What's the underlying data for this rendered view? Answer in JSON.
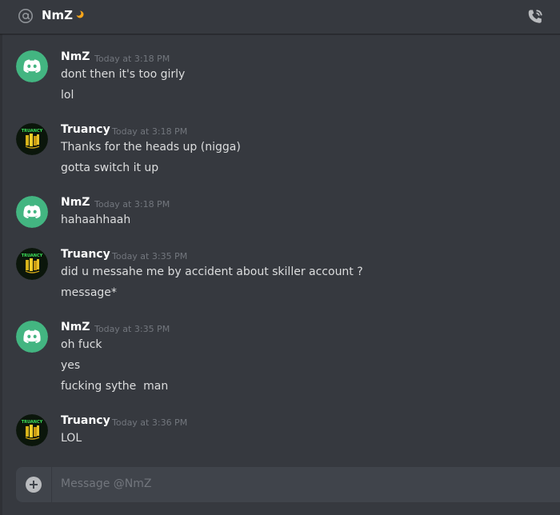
{
  "header": {
    "title": "NmZ",
    "icon": "at-icon",
    "status_icon": "moon-icon",
    "call_icon": "phone-call-icon"
  },
  "colors": {
    "background": "#36393f",
    "discord_green": "#43b581",
    "username": "#ffffff",
    "timestamp": "#72767d",
    "text": "#dcddde",
    "composer": "#40444b"
  },
  "messages": [
    {
      "author": "NmZ",
      "timestamp": "Today at 3:18 PM",
      "avatar": "discord-logo-avatar",
      "lines": [
        "dont then it's too girly",
        "lol"
      ]
    },
    {
      "author": "Truancy",
      "timestamp": "Today at 3:18 PM",
      "avatar": "truancy-avatar",
      "lines": [
        "Thanks for the heads up (nigga)",
        "gotta switch it up"
      ]
    },
    {
      "author": "NmZ",
      "timestamp": "Today at 3:18 PM",
      "avatar": "discord-logo-avatar",
      "lines": [
        "hahaahhaah"
      ]
    },
    {
      "author": "Truancy",
      "timestamp": "Today at 3:35 PM",
      "avatar": "truancy-avatar",
      "lines": [
        "did u messahe me by accident about skiller account ?",
        "message*"
      ]
    },
    {
      "author": "NmZ",
      "timestamp": "Today at 3:35 PM",
      "avatar": "discord-logo-avatar",
      "lines": [
        "oh fuck",
        "yes",
        "fucking sythe  man"
      ]
    },
    {
      "author": "Truancy",
      "timestamp": "Today at 3:36 PM",
      "avatar": "truancy-avatar",
      "lines": [
        "LOL"
      ]
    }
  ],
  "avatar_text": {
    "truancy": "TRUANCY"
  },
  "composer": {
    "placeholder": "Message @NmZ",
    "add_icon": "plus-circle-icon"
  }
}
